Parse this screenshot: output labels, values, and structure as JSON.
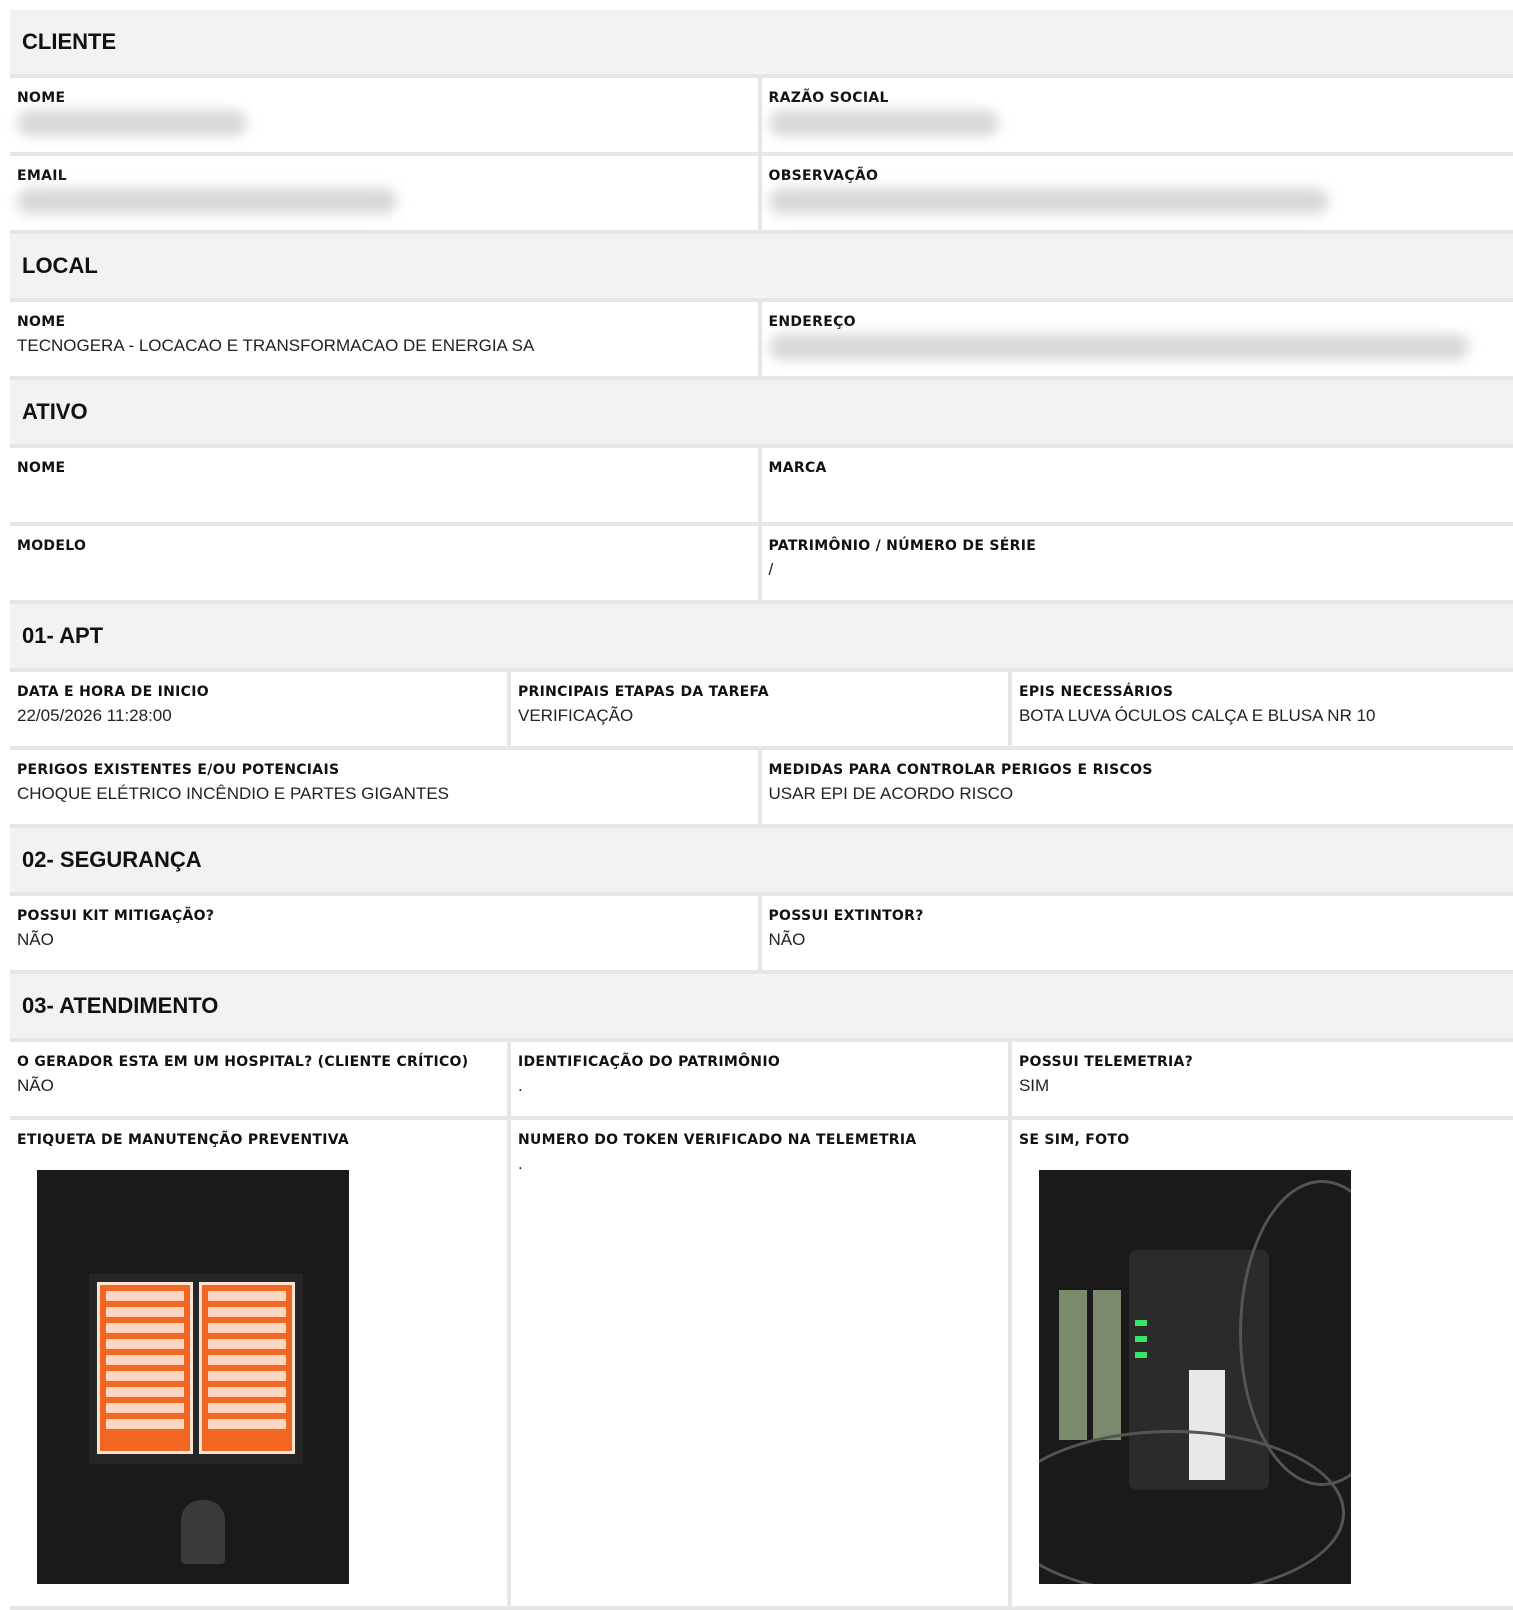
{
  "cliente": {
    "title": "CLIENTE",
    "nome_label": "NOME",
    "razao_label": "RAZÃO SOCIAL",
    "email_label": "EMAIL",
    "obs_label": "OBSERVAÇÃO"
  },
  "local": {
    "title": "LOCAL",
    "nome_label": "NOME",
    "nome_value": "TECNOGERA - LOCACAO E TRANSFORMACAO DE ENERGIA SA",
    "endereco_label": "ENDEREÇO"
  },
  "ativo": {
    "title": "ATIVO",
    "nome_label": "NOME",
    "marca_label": "MARCA",
    "modelo_label": "MODELO",
    "patrimonio_label": "PATRIMÔNIO / NÚMERO DE SÉRIE",
    "patrimonio_value": "/"
  },
  "apt": {
    "title": "01- APT",
    "data_label": "DATA E HORA DE INICIO",
    "data_value": "22/05/2026 11:28:00",
    "etapas_label": "PRINCIPAIS ETAPAS DA TAREFA",
    "etapas_value": "VERIFICAÇÃO",
    "epis_label": "EPIS NECESSÁRIOS",
    "epis_value": "BOTA LUVA ÓCULOS CALÇA E BLUSA NR 10",
    "perigos_label": "PERIGOS EXISTENTES E/OU POTENCIAIS",
    "perigos_value": "CHOQUE ELÉTRICO INCÊNDIO E PARTES GIGANTES",
    "medidas_label": "MEDIDAS PARA CONTROLAR PERIGOS E RISCOS",
    "medidas_value": "USAR EPI DE ACORDO RISCO"
  },
  "seguranca": {
    "title": "02- SEGURANÇA",
    "kit_label": "POSSUI KIT MITIGAÇÃO?",
    "kit_value": "NÃO",
    "extintor_label": "POSSUI EXTINTOR?",
    "extintor_value": "NÃO"
  },
  "atendimento": {
    "title": "03- ATENDIMENTO",
    "hospital_label": "O GERADOR ESTA EM UM HOSPITAL? (CLIENTE CRÍTICO)",
    "hospital_value": "NÃO",
    "ident_label": "IDENTIFICAÇÃO DO PATRIMÔNIO",
    "ident_value": ".",
    "telemetria_label": "POSSUI TELEMETRIA?",
    "telemetria_value": "SIM",
    "etiqueta_label": "ETIQUETA DE MANUTENÇÃO PREVENTIVA",
    "token_label": "NUMERO DO TOKEN VERIFICADO NA TELEMETRIA",
    "token_value": ".",
    "foto_label": "SE SIM, FOTO"
  }
}
